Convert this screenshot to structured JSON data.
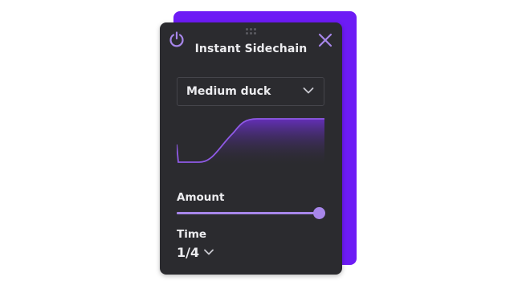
{
  "panel": {
    "title": "Instant Sidechain",
    "preset": {
      "selected": "Medium duck"
    },
    "amount": {
      "label": "Amount",
      "value_fraction": 0.96
    },
    "time": {
      "label": "Time",
      "value": "1/4"
    }
  },
  "icons": {
    "power": "power-icon",
    "close": "close-icon",
    "grip": "drag-handle-icon",
    "dropdown": "chevron-down-icon"
  },
  "colors": {
    "accent": "#a786ea",
    "accent_strong": "#6d1bf5",
    "panel_bg": "#2b2b2f",
    "text": "#ececef"
  }
}
